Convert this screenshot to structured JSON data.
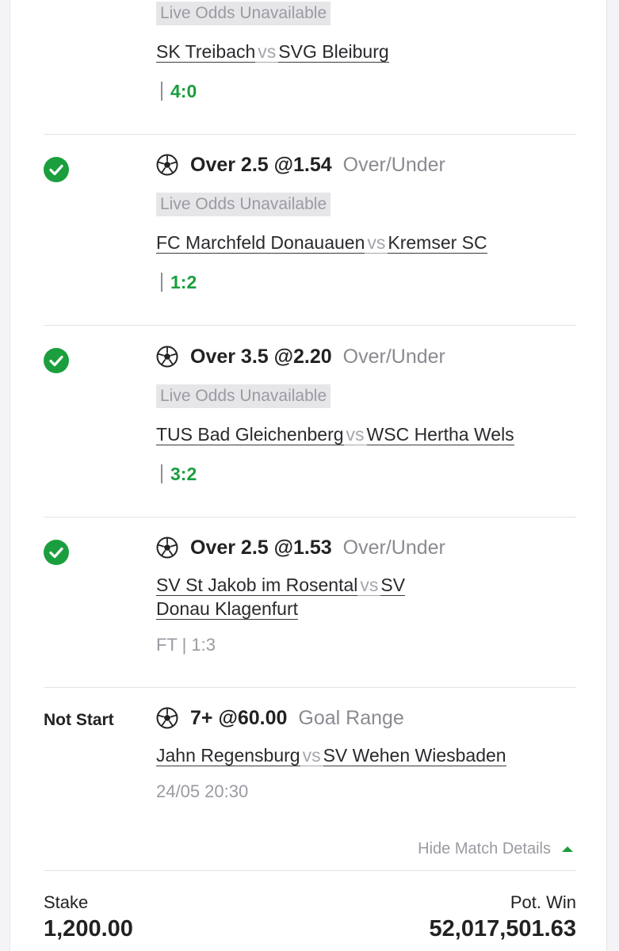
{
  "bets": [
    {
      "badge": "Live Odds Unavailable",
      "home": "SK Treibach",
      "vs": "vs",
      "away": "SVG Bleiburg",
      "score": "4:0"
    },
    {
      "status": "won",
      "sport_icon": "soccer-ball-icon",
      "pick": "Over 2.5 @1.54",
      "market": "Over/Under",
      "badge": "Live Odds Unavailable",
      "home": "FC Marchfeld Donauauen",
      "vs": "vs",
      "away": "Kremser SC",
      "score": "1:2"
    },
    {
      "status": "won",
      "sport_icon": "soccer-ball-icon",
      "pick": "Over 3.5 @2.20",
      "market": "Over/Under",
      "badge": "Live Odds Unavailable",
      "home": "TUS Bad Gleichenberg",
      "vs": "vs",
      "away": "WSC Hertha Wels",
      "score": "3:2"
    },
    {
      "status": "won",
      "sport_icon": "soccer-ball-icon",
      "pick": "Over 2.5 @1.53",
      "market": "Over/Under",
      "home": "SV St Jakob im Rosental",
      "vs": "vs",
      "away_line1": "SV",
      "away_line2": "Donau Klagenfurt",
      "result": "FT | 1:3"
    },
    {
      "status_label": "Not Start",
      "sport_icon": "soccer-ball-icon",
      "pick": "7+ @60.00",
      "market": "Goal Range",
      "home": "Jahn Regensburg",
      "vs": "vs",
      "away": "SV Wehen Wiesbaden",
      "datetime": "24/05 20:30"
    }
  ],
  "hide_details_label": "Hide Match Details",
  "footer": {
    "stake_label": "Stake",
    "stake_value": "1,200.00",
    "pot_win_label": "Pot. Win",
    "pot_win_value": "52,017,501.63"
  },
  "colors": {
    "win_green": "#1b9e3e",
    "muted_text": "#9a9aa2",
    "badge_bg": "#e6e6e9"
  }
}
